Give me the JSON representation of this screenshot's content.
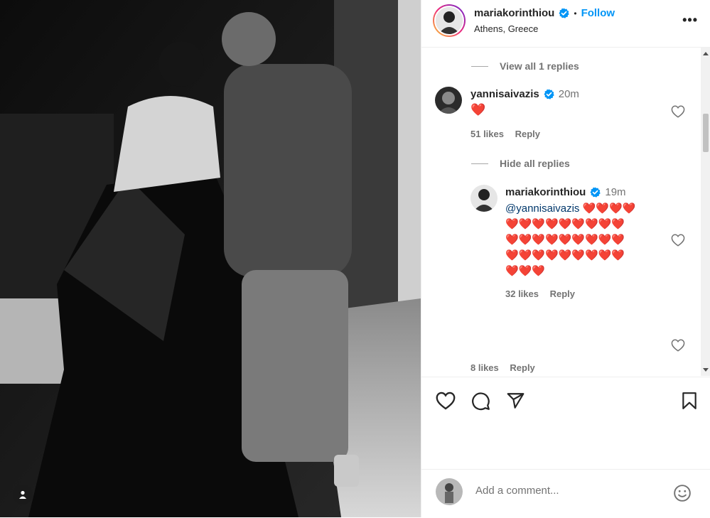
{
  "post": {
    "author": "mariakorinthiou",
    "follow_label": "Follow",
    "location": "Athens, Greece",
    "more_label": "•••"
  },
  "thread": {
    "view_replies_label": "View all 1 replies",
    "comment": {
      "username": "yannisaivazis",
      "time": "20m",
      "text": "❤️",
      "likes": "51 likes",
      "reply_label": "Reply"
    },
    "hide_replies_label": "Hide all replies",
    "reply": {
      "username": "mariakorinthiou",
      "time": "19m",
      "mention": "@yannisaivazis",
      "hearts_line1": "❤️❤️❤️❤️",
      "hearts_line2": "❤️❤️❤️❤️❤️❤️❤️❤️❤️",
      "hearts_line3": "❤️❤️❤️❤️❤️❤️❤️❤️❤️",
      "hearts_line4": "❤️❤️❤️❤️❤️❤️❤️❤️❤️",
      "hearts_line5": "❤️❤️❤️",
      "likes": "32 likes",
      "reply_label": "Reply"
    },
    "next_comment": {
      "likes": "8 likes",
      "reply_label": "Reply"
    }
  },
  "add_comment": {
    "placeholder": "Add a comment..."
  },
  "colors": {
    "accent": "#0095f6",
    "verified": "#0095f6",
    "heart": "#ed1c2e"
  },
  "icons": [
    "heart-icon",
    "comment-icon",
    "share-icon",
    "save-icon",
    "emoji-icon",
    "verified-icon",
    "user-tag-icon",
    "more-icon"
  ]
}
